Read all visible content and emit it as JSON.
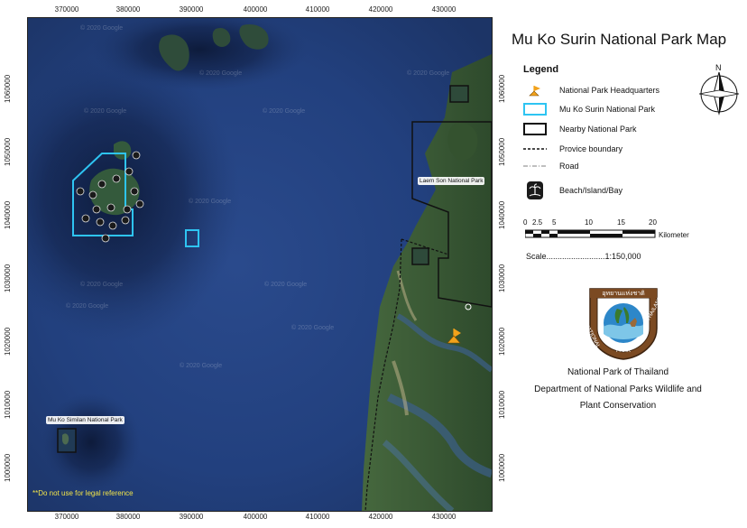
{
  "title": "Mu Ko Surin National Park Map",
  "axes": {
    "x_ticks": [
      "370000",
      "380000",
      "390000",
      "400000",
      "410000",
      "420000",
      "430000"
    ],
    "y_ticks": [
      "1060000",
      "1050000",
      "1040000",
      "1030000",
      "1020000",
      "1010000",
      "1000000"
    ]
  },
  "map_labels": {
    "laem_son": "Laem Son National Park",
    "similan": "Mu Ko Similan National Park",
    "disclaimer": "**Do not use for legal reference",
    "watermark": "© 2020 Google"
  },
  "legend": {
    "title": "Legend",
    "items": [
      {
        "id": "hq",
        "label": "National Park Headquarters",
        "icon": "hq-flag-icon"
      },
      {
        "id": "surin",
        "label": "Mu Ko Surin National Park",
        "icon": "cyan-boundary"
      },
      {
        "id": "nearby",
        "label": "Nearby National Park",
        "icon": "black-boundary"
      },
      {
        "id": "province",
        "label": "Provice boundary",
        "icon": "dashed-line"
      },
      {
        "id": "road",
        "label": "Road",
        "icon": "dashdot-line"
      },
      {
        "id": "beach",
        "label": "Beach/Island/Bay",
        "icon": "palm-island-icon"
      }
    ]
  },
  "north_label": "N",
  "scalebar": {
    "ticks": [
      "0",
      "2.5",
      "5",
      "10",
      "15",
      "20"
    ],
    "unit": "Kilometer",
    "scale_text": "Scale..........................1:150,000"
  },
  "logo": {
    "top_text": "อุทยานแห่งชาติ",
    "left_text": "NATIONAL",
    "bottom_text": "PARK",
    "right_text": "THAILAND"
  },
  "organization": {
    "line1": "National Park of Thailand",
    "line2": "Department of National Parks Wildlife and",
    "line3": "Plant Conservation"
  },
  "colors": {
    "sea": "#233c78",
    "land": "#3b5a3a",
    "surin_boundary": "#2ec4f2",
    "nearby_boundary": "#111111",
    "hq": "#f2a21b",
    "disclaimer": "#f2e44a"
  }
}
